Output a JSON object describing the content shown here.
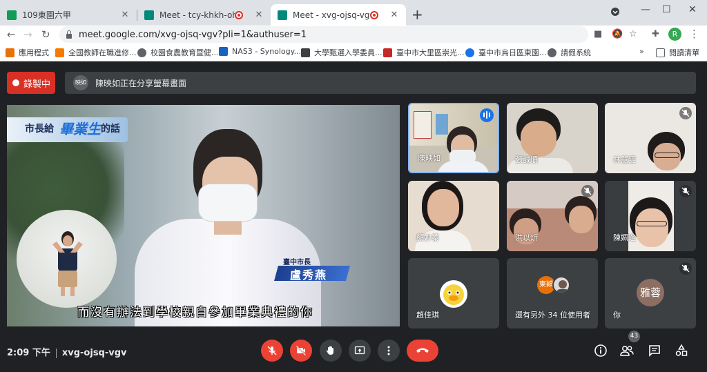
{
  "browser": {
    "tabs": [
      {
        "title": "109東園六甲",
        "favicon_color": "#0f9d58"
      },
      {
        "title": "Meet - tcy-khkh-ohi",
        "favicon_color": "#00897b"
      },
      {
        "title": "Meet - xvg-ojsq-vgv",
        "favicon_color": "#00897b"
      }
    ],
    "url": "meet.google.com/xvg-ojsq-vgv?pli=1&authuser=1",
    "profile_initial": "R",
    "bookmarks": [
      {
        "label": "應用程式",
        "icon_color": "#e8710a"
      },
      {
        "label": "全國教師在職進修...",
        "icon_color": "#f57c00"
      },
      {
        "label": "校園食農教育暨健...",
        "icon_color": "#5f6368"
      },
      {
        "label": "NAS3 - Synology...",
        "icon_color": "#1565c0"
      },
      {
        "label": "大學甄選入學委員...",
        "icon_color": "#3c4043"
      },
      {
        "label": "臺中市大里區崇光...",
        "icon_color": "#c62828"
      },
      {
        "label": "臺中市烏日區東園...",
        "icon_color": "#1a73e8"
      },
      {
        "label": "請假系統",
        "icon_color": "#5f6368"
      }
    ],
    "reading_list": "閱讀清單",
    "more": "»"
  },
  "meet": {
    "recording_label": "錄製中",
    "presenter_badge": "映如",
    "presenting_text": "陳映如正在分享螢幕畫面",
    "main_video": {
      "title_part1": "市長給",
      "title_part2": "畢業生",
      "title_part3": "的話",
      "name_label": "臺中市長",
      "name": "盧秀燕",
      "subtitle": "而沒有辦法到學校親自參加畢業典禮的你"
    },
    "participants": [
      {
        "name": "陳映如"
      },
      {
        "name": "張誠順"
      },
      {
        "name": "林慧雯"
      },
      {
        "name": "顏妙蓁"
      },
      {
        "name": "洪以炘"
      },
      {
        "name": "陳姵瑄"
      },
      {
        "name": "趙佳琪"
      },
      {
        "name": "還有另外 34 位使用者",
        "badge1": "東穎"
      },
      {
        "name": "你",
        "avatar": "雅蓉"
      }
    ],
    "time": "2:09 下午",
    "meeting_code": "xvg-ojsq-vgv",
    "participant_count": "43",
    "colors": {
      "accent_red": "#ea4335",
      "record_red": "#d93025",
      "active_blue": "#8ab4f8"
    }
  }
}
